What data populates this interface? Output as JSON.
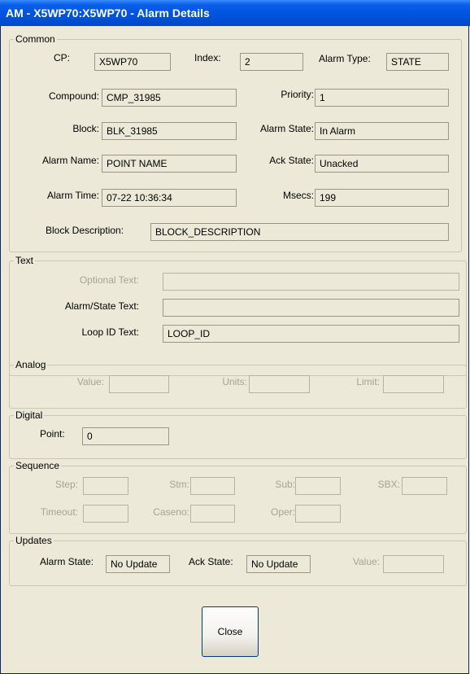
{
  "window": {
    "title": "AM - X5WP70:X5WP70 - Alarm Details"
  },
  "common": {
    "legend": "Common",
    "cp": {
      "label": "CP:",
      "value": "X5WP70"
    },
    "index": {
      "label": "Index:",
      "value": "2"
    },
    "alarm_type": {
      "label": "Alarm Type:",
      "value": "STATE"
    },
    "compound": {
      "label": "Compound:",
      "value": "CMP_31985"
    },
    "priority": {
      "label": "Priority:",
      "value": "1"
    },
    "block": {
      "label": "Block:",
      "value": "BLK_31985"
    },
    "alarm_state": {
      "label": "Alarm State:",
      "value": "In Alarm"
    },
    "alarm_name": {
      "label": "Alarm Name:",
      "value": "POINT NAME"
    },
    "ack_state": {
      "label": "Ack State:",
      "value": "Unacked"
    },
    "alarm_time": {
      "label": "Alarm Time:",
      "value": "07-22 10:36:34"
    },
    "msecs": {
      "label": "Msecs:",
      "value": "199"
    },
    "block_description": {
      "label": "Block Description:",
      "value": "BLOCK_DESCRIPTION"
    }
  },
  "text": {
    "legend": "Text",
    "optional_text": {
      "label": "Optional Text:",
      "value": ""
    },
    "alarm_state_text": {
      "label": "Alarm/State Text:",
      "value": ""
    },
    "loop_id_text": {
      "label": "Loop ID Text:",
      "value": "LOOP_ID"
    }
  },
  "analog": {
    "legend": "Analog",
    "value": {
      "label": "Value:",
      "value": ""
    },
    "units": {
      "label": "Units:",
      "value": ""
    },
    "limit": {
      "label": "Limit:",
      "value": ""
    }
  },
  "digital": {
    "legend": "Digital",
    "point": {
      "label": "Point:",
      "value": "0"
    }
  },
  "sequence": {
    "legend": "Sequence",
    "step": {
      "label": "Step:",
      "value": ""
    },
    "stm": {
      "label": "Stm:",
      "value": ""
    },
    "sub": {
      "label": "Sub:",
      "value": ""
    },
    "sbx": {
      "label": "SBX:",
      "value": ""
    },
    "timeout": {
      "label": "Timeout:",
      "value": ""
    },
    "caseno": {
      "label": "Caseno:",
      "value": ""
    },
    "oper": {
      "label": "Oper:",
      "value": ""
    }
  },
  "updates": {
    "legend": "Updates",
    "alarm_state": {
      "label": "Alarm State:",
      "value": "No Update"
    },
    "ack_state": {
      "label": "Ack State:",
      "value": "No Update"
    },
    "value": {
      "label": "Value:",
      "value": ""
    }
  },
  "close_button": "Close"
}
